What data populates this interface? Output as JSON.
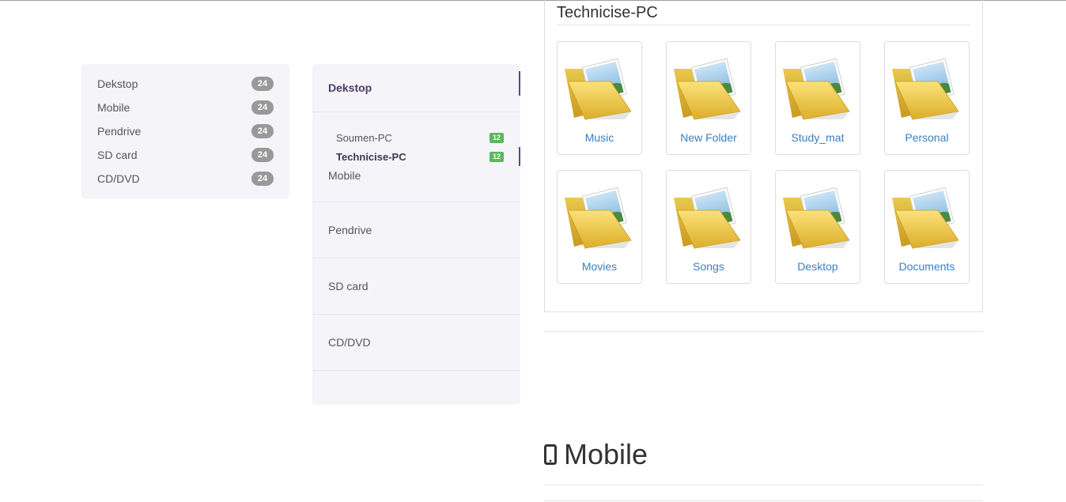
{
  "left_list": {
    "items": [
      {
        "label": "Dekstop",
        "count": "24"
      },
      {
        "label": "Mobile",
        "count": "24"
      },
      {
        "label": "Pendrive",
        "count": "24"
      },
      {
        "label": "SD card",
        "count": "24"
      },
      {
        "label": "CD/DVD",
        "count": "24"
      }
    ]
  },
  "mid_nav": {
    "header": "Dekstop",
    "sub_items": [
      {
        "label": "Soumen-PC",
        "count": "12"
      },
      {
        "label": "Technicise-PC",
        "count": "12"
      }
    ],
    "items": [
      "Mobile",
      "Pendrive",
      "SD card",
      "CD/DVD"
    ]
  },
  "panel": {
    "title": "Technicise-PC",
    "folders": [
      "Music",
      "New Folder",
      "Study_mat",
      "Personal",
      "Movies",
      "Songs",
      "Desktop",
      "Documents"
    ],
    "folder_icon": "folder-icon"
  },
  "section": {
    "title": "Mobile",
    "icon": "mobile-phone-icon"
  },
  "colors": {
    "nav_bg": "#f5f4f8",
    "accent": "#5b4a7a",
    "link": "#3a7fc1",
    "badge_gray": "#999999",
    "badge_green": "#5cb85c"
  }
}
